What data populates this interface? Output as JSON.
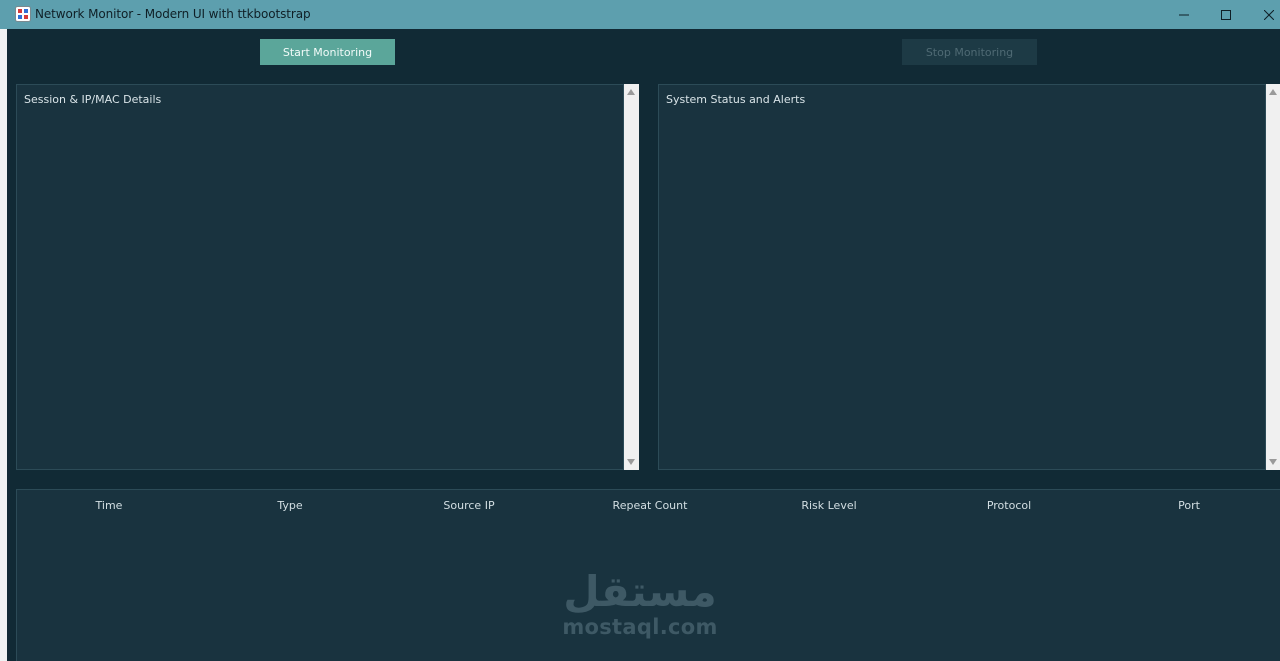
{
  "window": {
    "title": "Network Monitor - Modern UI with ttkbootstrap",
    "icon": "app-icon",
    "controls": [
      "minimize-icon",
      "maximize-icon",
      "close-icon"
    ]
  },
  "toolbar": {
    "start_label": "Start Monitoring",
    "stop_label": "Stop Monitoring",
    "stop_disabled": true
  },
  "panels": {
    "left_title": "Session & IP/MAC Details",
    "right_title": "System Status and Alerts"
  },
  "table": {
    "columns": [
      "Time",
      "Type",
      "Source IP",
      "Repeat Count",
      "Risk Level",
      "Protocol",
      "Port"
    ],
    "rows": []
  },
  "watermark": {
    "arabic": "مستقل",
    "latin": "mostaql.com"
  },
  "colors": {
    "titlebar": "#5d9fae",
    "background": "#112a35",
    "panel": "#19333f",
    "accent": "#5ba69a"
  }
}
